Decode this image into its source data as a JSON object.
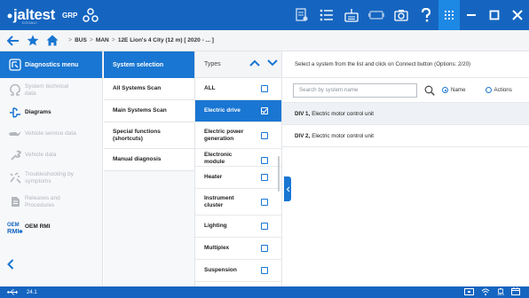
{
  "app": {
    "logo_text": "jaltest",
    "logo_subtext": "COJALI",
    "mode_label": "GRP"
  },
  "breadcrumb": {
    "items": [
      "BUS",
      "MAN",
      "12E Lion's 4 City (12 m) [ 2020 - ... ]"
    ]
  },
  "sidebar": {
    "header_label": "Diagnostics menu",
    "items": [
      {
        "label_line1": "System technical",
        "label_line2": "data",
        "state": "disabled",
        "icon": "ohm-icon"
      },
      {
        "label_line1": "Diagrams",
        "label_line2": "",
        "state": "active",
        "icon": "diagram-icon"
      },
      {
        "label_line1": "Vehicle service data",
        "label_line2": "",
        "state": "disabled",
        "icon": "oil-can-icon"
      },
      {
        "label_line1": "Vehicle data",
        "label_line2": "",
        "state": "disabled",
        "icon": "wrench-icon"
      },
      {
        "label_line1": "Troubleshooting by",
        "label_line2": "symptoms",
        "state": "disabled",
        "icon": "troubleshoot-icon"
      },
      {
        "label_line1": "Releases and",
        "label_line2": "Procedures",
        "state": "disabled",
        "icon": "document-icon"
      },
      {
        "label_line1": "OEM RMI",
        "label_line2": "",
        "state": "active",
        "icon": "oem-rmi-icon"
      }
    ]
  },
  "systems": {
    "header_label": "System selection",
    "items": [
      {
        "label_line1": "All Systems Scan",
        "label_line2": ""
      },
      {
        "label_line1": "Main Systems Scan",
        "label_line2": ""
      },
      {
        "label_line1": "Special functions",
        "label_line2": "(shortcuts)"
      },
      {
        "label_line1": "Manual diagnosis",
        "label_line2": ""
      }
    ]
  },
  "types": {
    "header_label": "Types",
    "items": [
      {
        "label_line1": "ALL",
        "label_line2": "",
        "checked": false,
        "selected": false
      },
      {
        "label_line1": "Electric drive",
        "label_line2": "",
        "checked": true,
        "selected": true
      },
      {
        "label_line1": "Electric power",
        "label_line2": "generation",
        "checked": false,
        "selected": false
      },
      {
        "label_line1": "Electronic",
        "label_line2": "module",
        "checked": false,
        "selected": false
      },
      {
        "label_line1": "Heater",
        "label_line2": "",
        "checked": false,
        "selected": false
      },
      {
        "label_line1": "Instrument",
        "label_line2": "cluster",
        "checked": false,
        "selected": false
      },
      {
        "label_line1": "Lighting",
        "label_line2": "",
        "checked": false,
        "selected": false
      },
      {
        "label_line1": "Multiplex",
        "label_line2": "",
        "checked": false,
        "selected": false
      },
      {
        "label_line1": "Suspension",
        "label_line2": "",
        "checked": false,
        "selected": false
      }
    ]
  },
  "panel": {
    "instruction": "Select a system from the list and click on Connect button (Options: 2/20)",
    "search_placeholder": "Search by system name",
    "radio_name_label": "Name",
    "radio_actions_label": "Actions",
    "radio_selected": "Name",
    "results": [
      {
        "code": "DIV 1,",
        "description": "Electric motor control unit"
      },
      {
        "code": "DIV 2,",
        "description": "Electric motor control unit"
      }
    ]
  },
  "status": {
    "version": "24.1",
    "battery_label": "100%"
  },
  "colors": {
    "primary": "#1565c0",
    "accent": "#1976d2",
    "disabled_text": "#b3b7bd"
  }
}
